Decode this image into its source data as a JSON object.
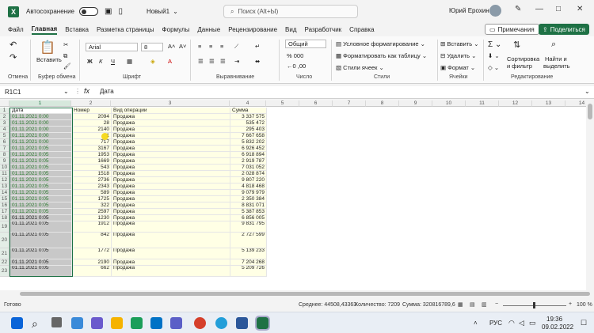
{
  "titlebar": {
    "autosave_label": "Автосохранение",
    "file_name": "Новый1",
    "search_placeholder": "Поиск (Alt+Ы)",
    "user_name": "Юрий Ерохин"
  },
  "menu": {
    "items": [
      "Файл",
      "Главная",
      "Вставка",
      "Разметка страницы",
      "Формулы",
      "Данные",
      "Рецензирование",
      "Вид",
      "Разработчик",
      "Справка"
    ],
    "active": "Главная",
    "notes": "Примечания",
    "share": "Поделиться"
  },
  "ribbon": {
    "paste": "Вставить",
    "font_name": "Arial",
    "font_size": "8",
    "number_format": "Общий",
    "cond_format": "Условное форматирование",
    "format_table": "Форматировать как таблицу",
    "cell_styles": "Стили ячеек",
    "insert": "Вставить",
    "delete": "Удалить",
    "format": "Формат",
    "sort_filter_1": "Сортировка",
    "sort_filter_2": "и фильтр",
    "find_1": "Найти и",
    "find_2": "выделить",
    "groups": [
      "Отмена",
      "Буфер обмена",
      "Шрифт",
      "Выравнивание",
      "Число",
      "Стили",
      "Ячейки",
      "Редактирование"
    ]
  },
  "formula": {
    "name_box": "R1C1",
    "fx": "fx",
    "content": "Дата"
  },
  "columns": [
    "1",
    "2",
    "3",
    "4",
    "5",
    "6",
    "7",
    "8",
    "9",
    "10",
    "11",
    "12",
    "13",
    "14",
    "15"
  ],
  "rows": [
    {
      "n": "1",
      "a": "Дата",
      "b": "Номер",
      "c": "Вид операции",
      "d": "Сумма"
    },
    {
      "n": "2",
      "a": "01.11.2021 0:00",
      "b": "2094",
      "c": "Продажа",
      "d": "3 337 575"
    },
    {
      "n": "3",
      "a": "01.11.2021 0:00",
      "b": "28",
      "c": "Продажа",
      "d": "535 472"
    },
    {
      "n": "4",
      "a": "01.11.2021 0:00",
      "b": "2140",
      "c": "Продажа",
      "d": "295 403"
    },
    {
      "n": "5",
      "a": "01.11.2021 0:00",
      "b": "1",
      "c": "Продажа",
      "d": "7 667 658"
    },
    {
      "n": "6",
      "a": "01.11.2021 0:00",
      "b": "717",
      "c": "Продажа",
      "d": "5 832 202"
    },
    {
      "n": "7",
      "a": "01.11.2021 0:05",
      "b": "3167",
      "c": "Продажа",
      "d": "6 926 452"
    },
    {
      "n": "8",
      "a": "01.11.2021 0:05",
      "b": "1953",
      "c": "Продажа",
      "d": "6 918 894"
    },
    {
      "n": "9",
      "a": "01.11.2021 0:05",
      "b": "1669",
      "c": "Продажа",
      "d": "2 919 787"
    },
    {
      "n": "10",
      "a": "01.11.2021 0:05",
      "b": "543",
      "c": "Продажа",
      "d": "7 031 052"
    },
    {
      "n": "11",
      "a": "01.11.2021 0:05",
      "b": "1518",
      "c": "Продажа",
      "d": "2 028 874"
    },
    {
      "n": "12",
      "a": "01.11.2021 0:05",
      "b": "2736",
      "c": "Продажа",
      "d": "9 807 220"
    },
    {
      "n": "13",
      "a": "01.11.2021 0:05",
      "b": "2343",
      "c": "Продажа",
      "d": "4 818 468"
    },
    {
      "n": "14",
      "a": "01.11.2021 0:05",
      "b": "589",
      "c": "Продажа",
      "d": "9 079 979"
    },
    {
      "n": "15",
      "a": "01.11.2021 0:05",
      "b": "1725",
      "c": "Продажа",
      "d": "2 350 384"
    },
    {
      "n": "16",
      "a": "01.11.2021 0:05",
      "b": "322",
      "c": "Продажа",
      "d": "8 831 071"
    },
    {
      "n": "17",
      "a": "01.11.2021 0:05",
      "b": "2597",
      "c": "Продажа",
      "d": "5 387 853"
    },
    {
      "n": "18",
      "a": "01.11.2021 0:05",
      "b": "1230",
      "c": "Продажа",
      "d": "6 856 005"
    },
    {
      "n": "19",
      "a": "01.11.2021 0:05",
      "b": "1912",
      "c": "Продажа",
      "d": "9 831 795"
    },
    {
      "n": "20",
      "a": "01.11.2021 0:05",
      "b": "842",
      "c": "Продажа",
      "d": "2 727 599"
    },
    {
      "n": "21",
      "a": "01.11.2021 0:05",
      "b": "1772",
      "c": "Продажа",
      "d": "5 139 233"
    },
    {
      "n": "22",
      "a": "01.11.2021 0:05",
      "b": "2190",
      "c": "Продажа",
      "d": "7 204 268"
    },
    {
      "n": "23",
      "a": "01.11.2021 0:05",
      "b": "662",
      "c": "Продажа",
      "d": "5 209 726"
    }
  ],
  "status": {
    "ready": "Готово",
    "avg": "Среднее: 44508,43363",
    "count": "Количество: 7209",
    "sum": "Сумма: 320816789,6",
    "zoom": "100 %"
  },
  "taskbar": {
    "lang": "РУС",
    "time": "19:36",
    "date": "09.02.2022"
  },
  "colors": {
    "accent": "#1e7145",
    "selection": "#c8c8c8",
    "header_fill": "#ffffe5"
  }
}
